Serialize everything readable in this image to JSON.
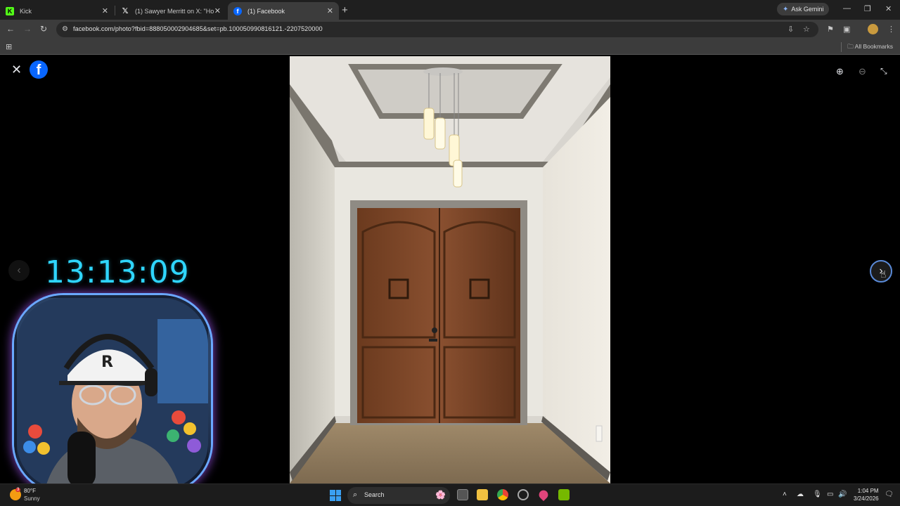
{
  "browser": {
    "tabs": [
      {
        "title": "Kick",
        "favicon": "kick-icon",
        "color": "#53fc18"
      },
      {
        "title": "(1) Sawyer Merritt on X: \"Holy m",
        "favicon": "x-icon",
        "color": "#ffffff"
      },
      {
        "title": "(1) Facebook",
        "favicon": "facebook-icon",
        "color": "#0866ff"
      }
    ],
    "ask_gemini": "Ask Gemini",
    "url": "facebook.com/photo?fbid=888050002904685&set=pb.100050990816121.-2207520000",
    "bookmarks_label": "All Bookmarks"
  },
  "viewer": {
    "brand_color": "#0866ff",
    "logo_letter": "f",
    "photo_subject": "entryway with wooden double doors and pendant lights"
  },
  "overlay": {
    "clock": "13:13:09",
    "clock_color": "#2fd6ff"
  },
  "taskbar": {
    "temperature": "80°F",
    "condition": "Sunny",
    "weather_badge": "3",
    "search_label": "Search",
    "time": "1:04 PM",
    "date": "3/24/2026"
  }
}
